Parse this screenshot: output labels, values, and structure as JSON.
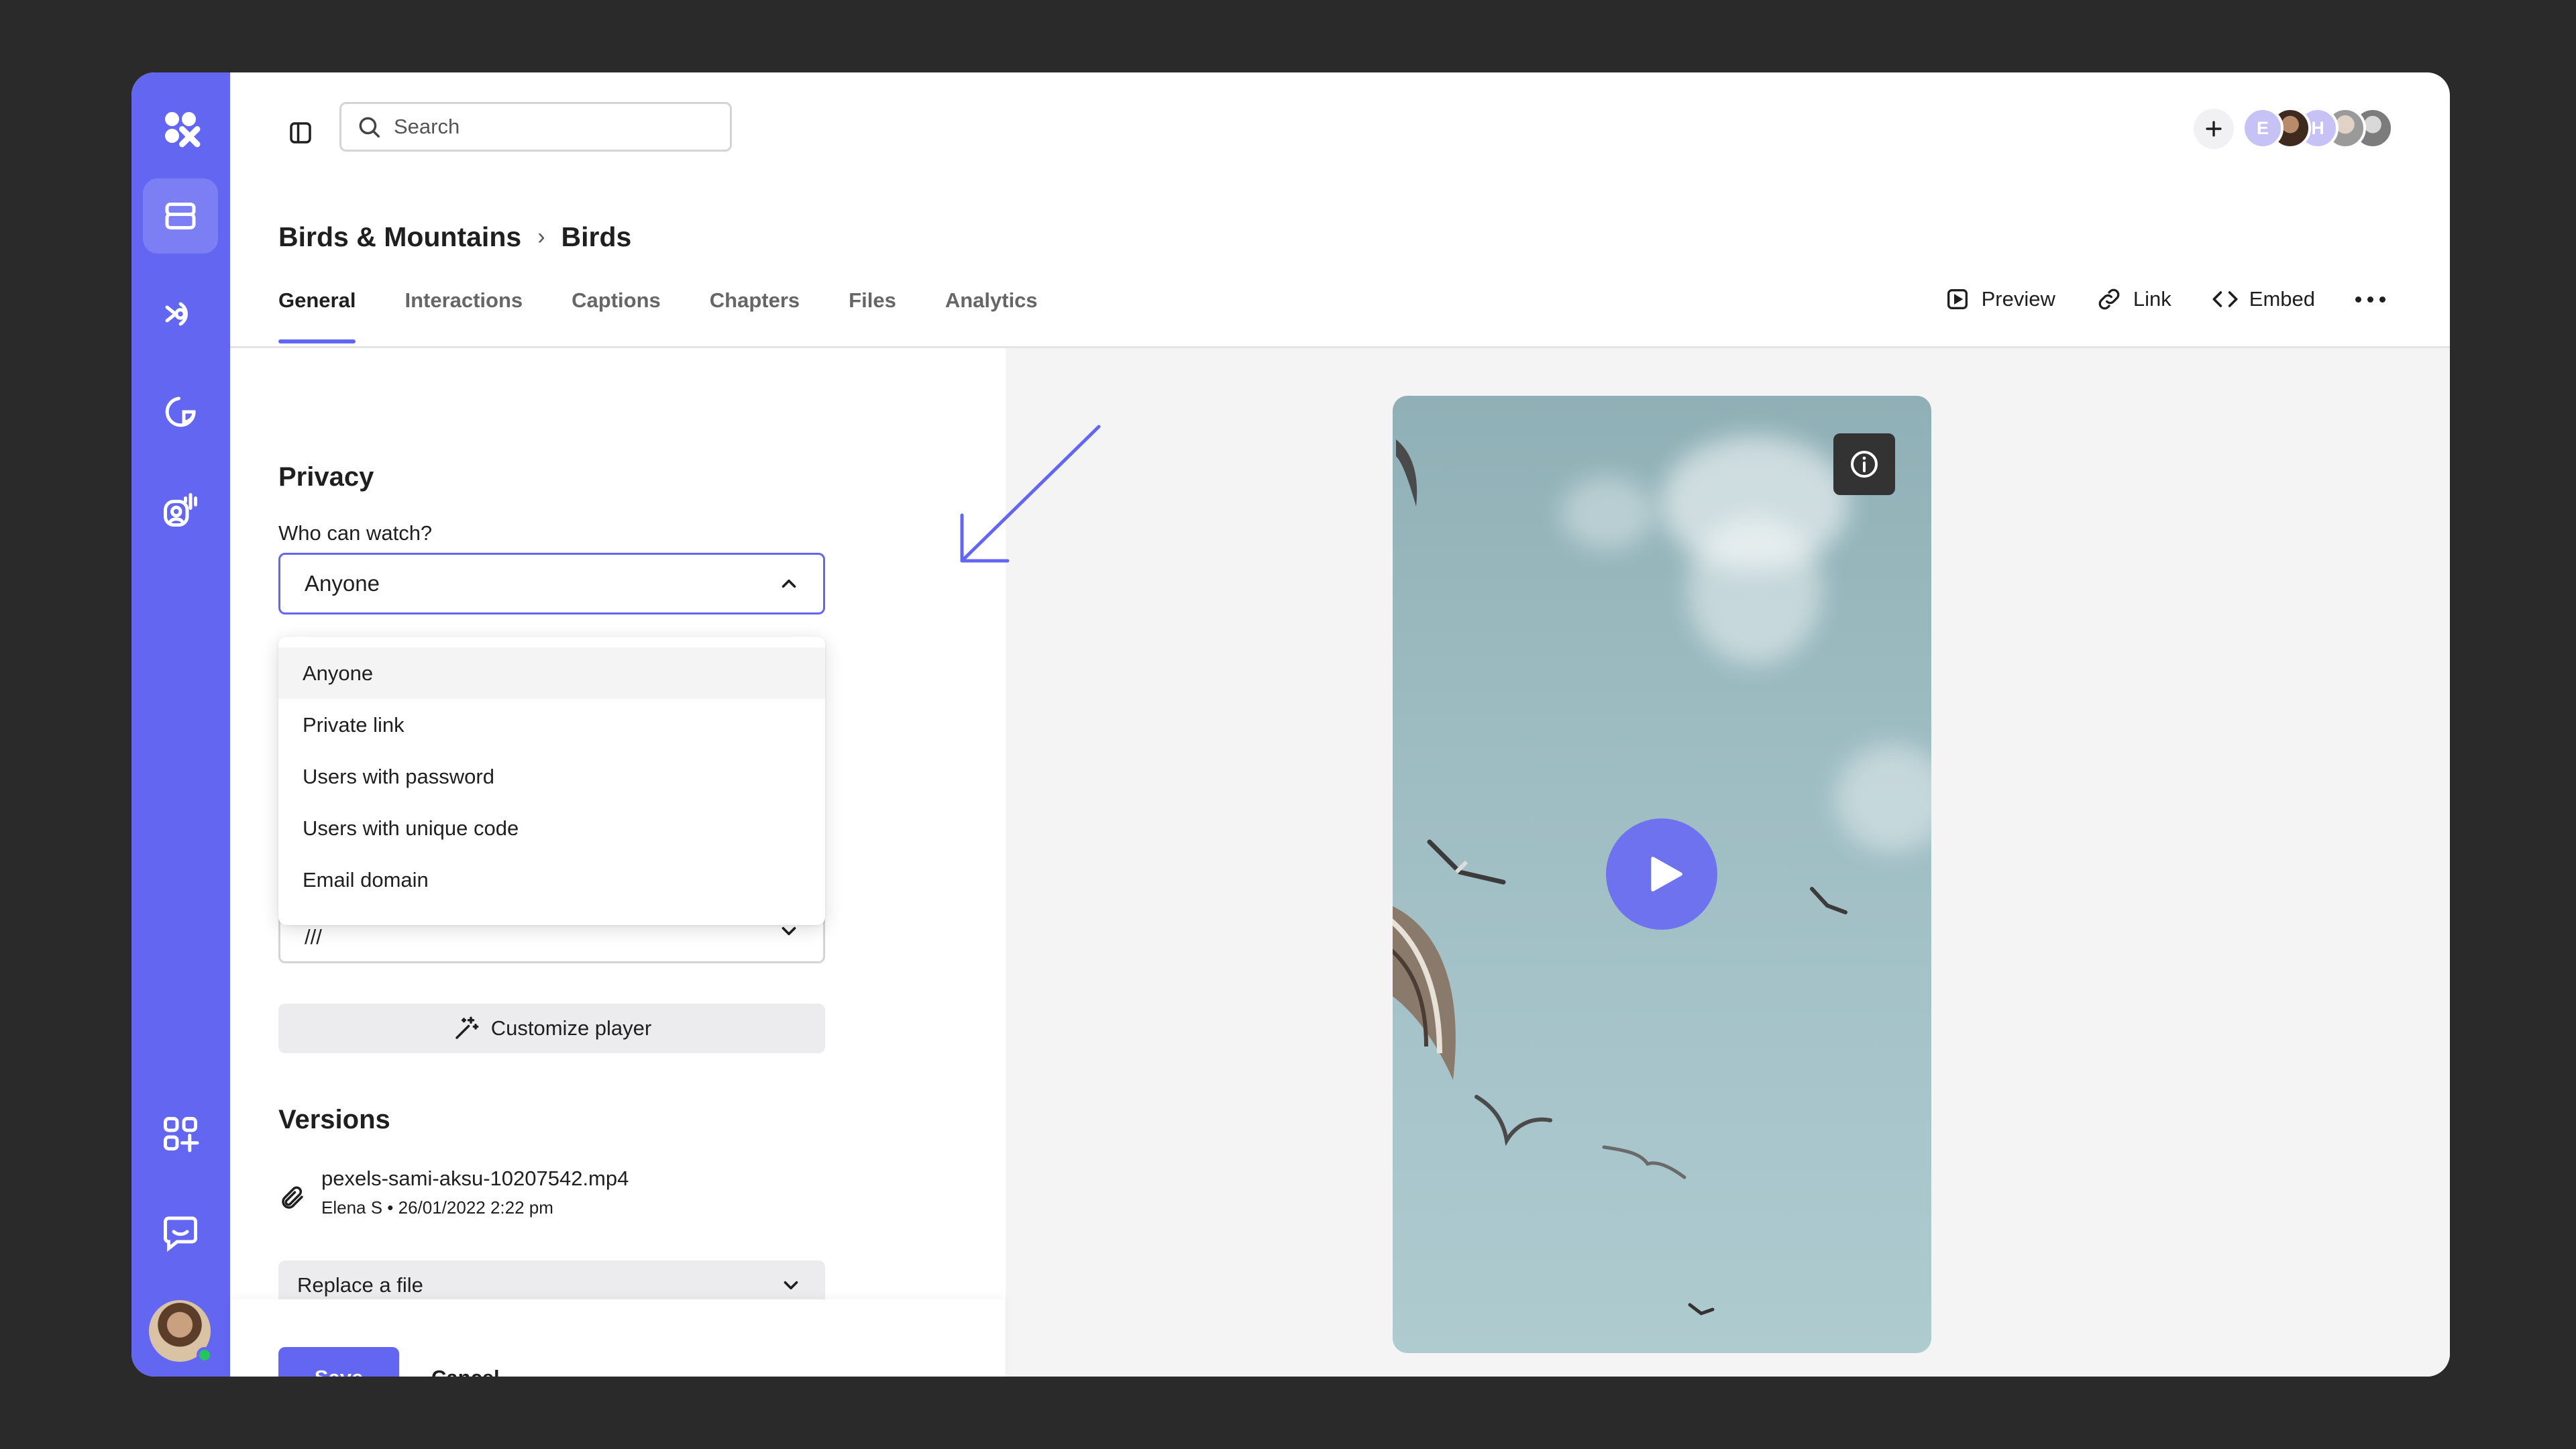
{
  "search": {
    "placeholder": "Search"
  },
  "header_avatars": [
    {
      "initial": "E"
    },
    {
      "initial": "H"
    }
  ],
  "breadcrumb": {
    "parent": "Birds & Mountains",
    "separator": "›",
    "current": "Birds"
  },
  "tabs": [
    {
      "label": "General",
      "active": true
    },
    {
      "label": "Interactions"
    },
    {
      "label": "Captions"
    },
    {
      "label": "Chapters"
    },
    {
      "label": "Files"
    },
    {
      "label": "Analytics"
    }
  ],
  "actions": {
    "preview": "Preview",
    "link": "Link",
    "embed": "Embed"
  },
  "privacy": {
    "heading": "Privacy",
    "who_label": "Who can watch?",
    "selected": "Anyone",
    "options": [
      "Anyone",
      "Private link",
      "Users with password",
      "Users with unique code",
      "Email domain"
    ],
    "second_select_value": "///"
  },
  "customize_label": "Customize player",
  "versions": {
    "heading": "Versions",
    "file_name": "pexels-sami-aksu-10207542.mp4",
    "file_meta": "Elena S • 26/01/2022 2:22 pm",
    "replace_label": "Replace a file"
  },
  "footer": {
    "save": "Save",
    "cancel": "Cancel"
  },
  "colors": {
    "accent": "#6366f1",
    "background": "#2a2a2a",
    "panel": "#f4f4f5"
  },
  "icons": {
    "rail": [
      "logo-icon",
      "folder-icon",
      "broadcast-icon",
      "analytics-icon",
      "ai-avatar-icon",
      "apps-icon",
      "chat-icon"
    ],
    "toolbar": [
      "sidebar-toggle-icon",
      "search-icon",
      "plus-icon",
      "preview-icon",
      "link-icon",
      "embed-icon",
      "more-icon"
    ]
  }
}
